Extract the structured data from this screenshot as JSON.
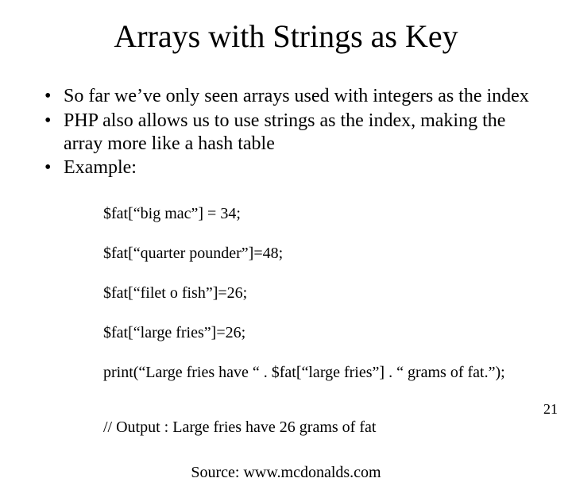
{
  "title": "Arrays with Strings as Key",
  "bullets": [
    "So far we’ve only seen arrays used with integers as the index",
    "PHP also allows us to use strings as the index, making the array more like a hash table",
    "Example:"
  ],
  "code_lines": [
    "$fat[“big mac”] = 34;",
    "$fat[“quarter pounder”]=48;",
    "$fat[“filet o fish”]=26;",
    "$fat[“large fries”]=26;",
    "print(“Large fries have “ . $fat[“large fries”] . “ grams of fat.”);"
  ],
  "output_line": "// Output : Large fries have 26 grams of fat",
  "source": "Source: www.mcdonalds.com",
  "page_number": "21"
}
